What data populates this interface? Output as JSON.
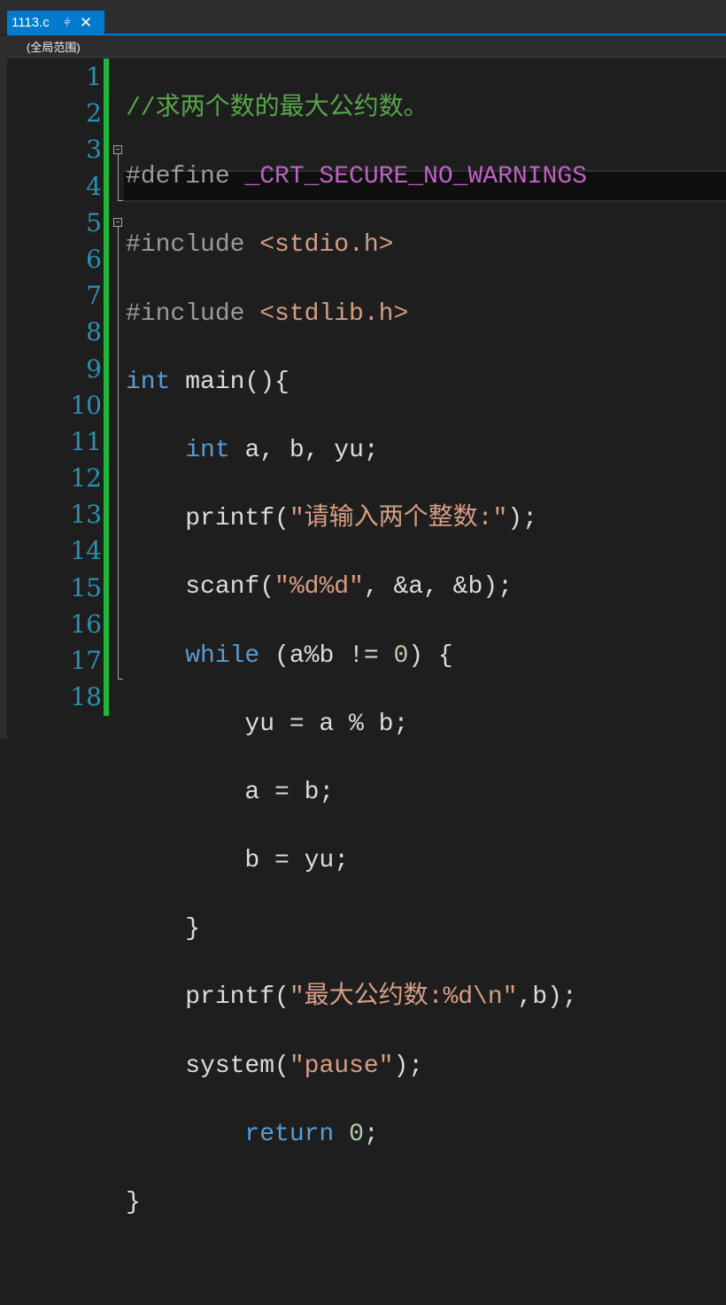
{
  "tab": {
    "title": "1113.c",
    "pin_icon": "pin-icon",
    "close_icon": "close-icon"
  },
  "scope": {
    "label": "(全局范围)"
  },
  "colors": {
    "accent": "#007acc",
    "change_bar": "#1fb83b",
    "line_number": "#2b91af"
  },
  "line_numbers": [
    "1",
    "2",
    "3",
    "4",
    "5",
    "6",
    "7",
    "8",
    "9",
    "10",
    "11",
    "12",
    "13",
    "14",
    "15",
    "16",
    "17",
    "18"
  ],
  "code": {
    "l1": "//求两个数的最大公约数。",
    "l2_pre": "#define ",
    "l2_macro": "_CRT_SECURE_NO_WARNINGS",
    "l3_pre": "#include ",
    "l3_hdr": "<stdio.h>",
    "l4_pre": "#include ",
    "l4_hdr": "<stdlib.h>",
    "l5_kw": "int",
    "l5_rest": " main(){",
    "l6_indent": "    ",
    "l6_kw": "int",
    "l6_rest": " a, b, yu;",
    "l7_a": "    printf(",
    "l7_str": "\"请输入两个整数:\"",
    "l7_b": ");",
    "l8_a": "    scanf(",
    "l8_str": "\"%d%d\"",
    "l8_b": ", &a, &b);",
    "l9_indent": "    ",
    "l9_kw": "while",
    "l9_a": " (a%b != ",
    "l9_num": "0",
    "l9_b": ") {",
    "l10": "        yu = a % b;",
    "l11": "        a = b;",
    "l12": "        b = yu;",
    "l13": "    }",
    "l14_a": "    printf(",
    "l14_str": "\"最大公约数:%d\\n\"",
    "l14_b": ",b);",
    "l15_a": "    system(",
    "l15_str": "\"pause\"",
    "l15_b": ");",
    "l16_indent": "        ",
    "l16_kw": "return",
    "l16_sp": " ",
    "l16_num": "0",
    "l16_b": ";",
    "l17": "}",
    "l18": ""
  }
}
